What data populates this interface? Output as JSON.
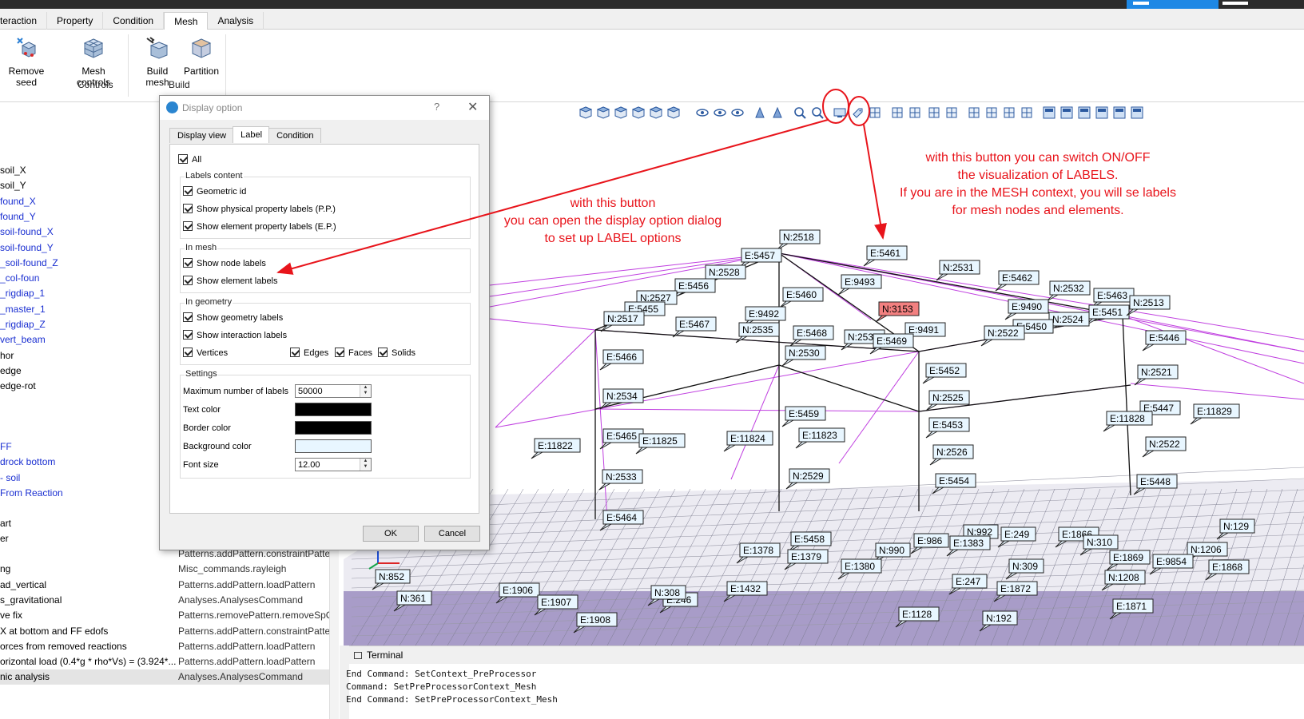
{
  "ribbon": {
    "tabs": [
      "teraction",
      "Property",
      "Condition",
      "Mesh",
      "Analysis"
    ],
    "active_tab": "Mesh",
    "buttons": {
      "remove_seed": "Remove seed",
      "mesh_controls": "Mesh controls",
      "build_mesh": "Build mesh",
      "partition": "Partition"
    },
    "groups": {
      "controls": "Controls",
      "build": "Build"
    }
  },
  "left_panel": {
    "items": [
      {
        "text": "soil_X",
        "color": "black"
      },
      {
        "text": "soil_Y",
        "color": "black"
      },
      {
        "text": "found_X",
        "color": "blue"
      },
      {
        "text": "found_Y",
        "color": "blue"
      },
      {
        "text": "soil-found_X",
        "color": "blue"
      },
      {
        "text": "soil-found_Y",
        "color": "blue"
      },
      {
        "text": "_soil-found_Z",
        "color": "blue"
      },
      {
        "text": "_col-foun",
        "color": "blue"
      },
      {
        "text": "_rigdiap_1",
        "color": "blue"
      },
      {
        "text": "_master_1",
        "color": "blue"
      },
      {
        "text": "_rigdiap_Z",
        "color": "blue"
      },
      {
        "text": "vert_beam",
        "color": "blue"
      },
      {
        "text": "hor",
        "color": "black"
      },
      {
        "text": "edge",
        "color": "black"
      },
      {
        "text": "edge-rot",
        "color": "black"
      }
    ],
    "items2": [
      {
        "text": "FF",
        "color": "blue"
      },
      {
        "text": "drock bottom",
        "color": "blue"
      },
      {
        "text": "- soil",
        "color": "blue"
      },
      {
        "text": "From Reaction",
        "color": "blue"
      }
    ],
    "items3": [
      {
        "text": "art",
        "color": "black"
      },
      {
        "text": "er",
        "color": "black"
      }
    ],
    "rows": [
      {
        "name": "",
        "command": "Patterns.addPattern.constraintPatter"
      },
      {
        "name": "ng",
        "command": "Misc_commands.rayleigh"
      },
      {
        "name": "ad_vertical",
        "command": "Patterns.addPattern.loadPattern"
      },
      {
        "name": "s_gravitational",
        "command": "Analyses.AnalysesCommand"
      },
      {
        "name": "ve fix",
        "command": "Patterns.removePattern.removeSpCo"
      },
      {
        "name": "X at bottom and FF edofs",
        "command": "Patterns.addPattern.constraintPatter"
      },
      {
        "name": "orces from removed reactions",
        "command": "Patterns.addPattern.loadPattern"
      },
      {
        "name": "orizontal load (0.4*g * rho*Vs) = (3.924*...",
        "command": "Patterns.addPattern.loadPattern"
      },
      {
        "name": "nic analysis",
        "command": "Analyses.AnalysesCommand"
      }
    ]
  },
  "dialog": {
    "title": "Display option",
    "help": "?",
    "close": "✕",
    "tabs": [
      "Display view",
      "Label",
      "Condition"
    ],
    "active_tab": "Label",
    "all": "All",
    "labels_content": {
      "title": "Labels content",
      "geometric_id": "Geometric id",
      "physical": "Show physical property labels (P.P.)",
      "element": "Show element property labels (E.P.)"
    },
    "in_mesh": {
      "title": "In mesh",
      "node_labels": "Show node labels",
      "element_labels": "Show element labels"
    },
    "in_geometry": {
      "title": "In geometry",
      "geometry_labels": "Show geometry labels",
      "interaction_labels": "Show interaction labels",
      "vertices": "Vertices",
      "edges": "Edges",
      "faces": "Faces",
      "solids": "Solids"
    },
    "settings": {
      "title": "Settings",
      "max_labels_label": "Maximum number of labels",
      "max_labels_value": "50000",
      "text_color_label": "Text color",
      "text_color": "#000000",
      "border_color_label": "Border color",
      "border_color": "#000000",
      "background_color_label": "Background color",
      "background_color": "#e8f6ff",
      "font_size_label": "Font size",
      "font_size_value": "12.00"
    },
    "ok": "OK",
    "cancel": "Cancel"
  },
  "annotations": {
    "left": [
      "with this button",
      "you can open the display option dialog",
      "to set up LABEL options"
    ],
    "right": [
      "with this button you can switch ON/OFF",
      "the visualization of LABELS.",
      "If you are in the MESH context, you will se labels",
      "for mesh nodes and elements."
    ],
    "color": "#e8141b"
  },
  "mesh_labels": [
    {
      "t": "N:2518"
    },
    {
      "t": "E:5457"
    },
    {
      "t": "E:5461"
    },
    {
      "t": "N:2531"
    },
    {
      "t": "N:2528"
    },
    {
      "t": "E:5462"
    },
    {
      "t": "N:2532"
    },
    {
      "t": "E:5463"
    },
    {
      "t": "E:5456"
    },
    {
      "t": "E:9493"
    },
    {
      "t": "N:2527"
    },
    {
      "t": "E:5460"
    },
    {
      "t": "E:5455"
    },
    {
      "t": "E:9492"
    },
    {
      "t": "N:3153",
      "hl": true
    },
    {
      "t": "E:9490"
    },
    {
      "t": "E:5451"
    },
    {
      "t": "N:2513"
    },
    {
      "t": "N:2517"
    },
    {
      "t": "E:5467"
    },
    {
      "t": "N:2535"
    },
    {
      "t": "E:5468"
    },
    {
      "t": "E:9491"
    },
    {
      "t": "N:2524"
    },
    {
      "t": "E:5450"
    },
    {
      "t": "N:2536"
    },
    {
      "t": "E:5469"
    },
    {
      "t": "N:2522"
    },
    {
      "t": "E:5446"
    },
    {
      "t": "N:2530"
    },
    {
      "t": "E:5466"
    },
    {
      "t": "E:5452"
    },
    {
      "t": "N:2521"
    },
    {
      "t": "N:2534"
    },
    {
      "t": "N:2525"
    },
    {
      "t": "E:5447"
    },
    {
      "t": "E:5459"
    },
    {
      "t": "E:11828"
    },
    {
      "t": "E:11829"
    },
    {
      "t": "E:5465"
    },
    {
      "t": "E:11825"
    },
    {
      "t": "E:11824"
    },
    {
      "t": "E:11823"
    },
    {
      "t": "E:5453"
    },
    {
      "t": "E:11822"
    },
    {
      "t": "N:2522"
    },
    {
      "t": "N:2526"
    },
    {
      "t": "N:2533"
    },
    {
      "t": "N:2529"
    },
    {
      "t": "E:5454"
    },
    {
      "t": "E:5448"
    },
    {
      "t": "E:5464"
    },
    {
      "t": "E:5458"
    },
    {
      "t": "N:990"
    },
    {
      "t": "N:992"
    },
    {
      "t": "E:986"
    },
    {
      "t": "E:1383"
    },
    {
      "t": "E:249"
    },
    {
      "t": "E:1866"
    },
    {
      "t": "N:129"
    },
    {
      "t": "E:1378"
    },
    {
      "t": "E:1379"
    },
    {
      "t": "E:1380"
    },
    {
      "t": "E:1869"
    },
    {
      "t": "N:1206"
    },
    {
      "t": "E:9854"
    },
    {
      "t": "N:310"
    },
    {
      "t": "E:1868"
    },
    {
      "t": "N:309"
    },
    {
      "t": "N:1208"
    },
    {
      "t": "E:247"
    },
    {
      "t": "E:1872"
    },
    {
      "t": "E:1906"
    },
    {
      "t": "E:1907"
    },
    {
      "t": "N:361"
    },
    {
      "t": "N:852"
    },
    {
      "t": "E:1432"
    },
    {
      "t": "E:1128"
    },
    {
      "t": "E:1871"
    },
    {
      "t": "E:1908"
    },
    {
      "t": "N:192"
    },
    {
      "t": "E:246"
    },
    {
      "t": "N:308"
    }
  ],
  "terminal": {
    "title": "Terminal",
    "lines": [
      "End Command: SetContext_PreProcessor",
      "Command: SetPreProcessorContext_Mesh",
      "End Command: SetPreProcessorContext_Mesh"
    ]
  },
  "colors": {
    "accent": "#1e88e5",
    "annotation": "#e8141b",
    "mesh_magenta": "#c040e0",
    "highlight_label": "#f28080"
  }
}
